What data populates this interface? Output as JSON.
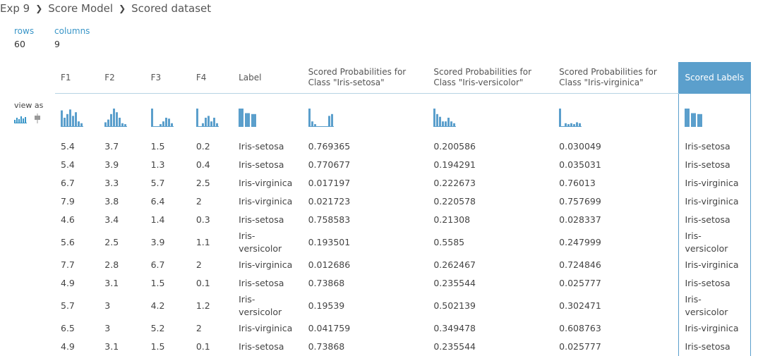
{
  "breadcrumb": {
    "items": [
      "Exp 9",
      "Score Model",
      "Scored dataset"
    ]
  },
  "stats": {
    "rows": {
      "label": "rows",
      "value": "60"
    },
    "columns": {
      "label": "columns",
      "value": "9"
    }
  },
  "viewas": {
    "label": "view as",
    "icons": [
      "histogram-icon",
      "boxplot-icon"
    ]
  },
  "columns": [
    "F1",
    "F2",
    "F3",
    "F4",
    "Label",
    "Scored Probabilities for Class \"Iris-setosa\"",
    "Scored Probabilities for Class \"Iris-versicolor\"",
    "Scored Probabilities for Class \"Iris-virginica\"",
    "Scored Labels"
  ],
  "selected_column": "Scored Labels",
  "accent": "#5b9fcc",
  "rows": [
    [
      "5.4",
      "3.7",
      "1.5",
      "0.2",
      "Iris-setosa",
      "0.769365",
      "0.200586",
      "0.030049",
      "Iris-setosa"
    ],
    [
      "5.4",
      "3.9",
      "1.3",
      "0.4",
      "Iris-setosa",
      "0.770677",
      "0.194291",
      "0.035031",
      "Iris-setosa"
    ],
    [
      "6.7",
      "3.3",
      "5.7",
      "2.5",
      "Iris-virginica",
      "0.017197",
      "0.222673",
      "0.76013",
      "Iris-virginica"
    ],
    [
      "7.9",
      "3.8",
      "6.4",
      "2",
      "Iris-virginica",
      "0.021723",
      "0.220578",
      "0.757699",
      "Iris-virginica"
    ],
    [
      "4.6",
      "3.4",
      "1.4",
      "0.3",
      "Iris-setosa",
      "0.758583",
      "0.21308",
      "0.028337",
      "Iris-setosa"
    ],
    [
      "5.6",
      "2.5",
      "3.9",
      "1.1",
      "Iris-versicolor",
      "0.193501",
      "0.5585",
      "0.247999",
      "Iris-versicolor"
    ],
    [
      "7.7",
      "2.8",
      "6.7",
      "2",
      "Iris-virginica",
      "0.012686",
      "0.262467",
      "0.724846",
      "Iris-virginica"
    ],
    [
      "4.9",
      "3.1",
      "1.5",
      "0.1",
      "Iris-setosa",
      "0.73868",
      "0.235544",
      "0.025777",
      "Iris-setosa"
    ],
    [
      "5.7",
      "3",
      "4.2",
      "1.2",
      "Iris-versicolor",
      "0.19539",
      "0.502139",
      "0.302471",
      "Iris-versicolor"
    ],
    [
      "6.5",
      "3",
      "5.2",
      "2",
      "Iris-virginica",
      "0.041759",
      "0.349478",
      "0.608763",
      "Iris-virginica"
    ],
    [
      "4.9",
      "3.1",
      "1.5",
      "0.1",
      "Iris-setosa",
      "0.73868",
      "0.235544",
      "0.025777",
      "Iris-setosa"
    ]
  ],
  "histograms": [
    [
      0.9,
      0.5,
      0.7,
      0.95,
      0.6,
      0.8,
      0.3,
      0.2
    ],
    [
      0.25,
      0.4,
      0.7,
      1.0,
      0.8,
      0.5,
      0.2,
      0.15
    ],
    [
      1.0,
      0.0,
      0.0,
      0.15,
      0.3,
      0.5,
      0.45,
      0.2
    ],
    [
      1.0,
      0.0,
      0.2,
      0.5,
      0.6,
      0.3,
      0.5,
      0.2
    ],
    [
      1.0,
      0.75,
      0.7
    ],
    [
      1.0,
      0.3,
      0.15,
      0.0,
      0.0,
      0.0,
      0.0,
      0.6,
      0.7
    ],
    [
      1.0,
      0.7,
      0.55,
      0.3,
      0.3,
      0.5,
      0.3,
      0.2
    ],
    [
      1.0,
      0.0,
      0.2,
      0.15,
      0.2,
      0.15,
      0.25,
      0.2
    ],
    [
      1.0,
      0.75,
      0.7
    ]
  ]
}
